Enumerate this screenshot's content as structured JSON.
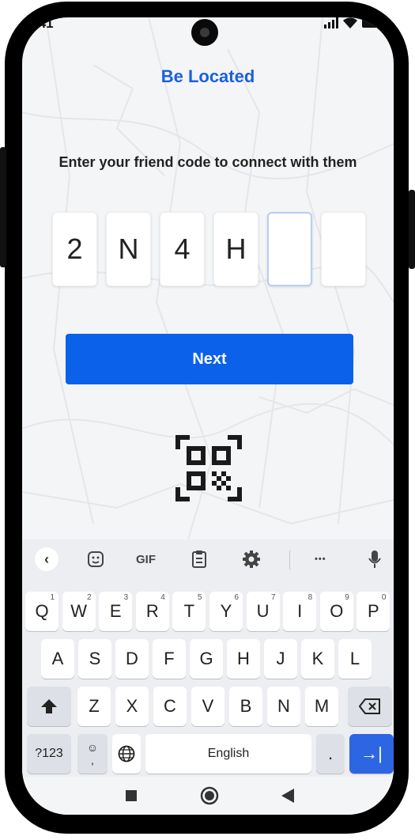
{
  "status": {
    "time": ".41"
  },
  "app": {
    "brand": "Be Located"
  },
  "connect": {
    "prompt": "Enter your friend code to connect with them",
    "code_chars": [
      "2",
      "N",
      "4",
      "H",
      "",
      ""
    ],
    "next_label": "Next"
  },
  "keyboard": {
    "toolbar": {
      "gif_label": "GIF",
      "more_label": "•••"
    },
    "row1": [
      {
        "key": "Q",
        "hint": "1"
      },
      {
        "key": "W",
        "hint": "2"
      },
      {
        "key": "E",
        "hint": "3"
      },
      {
        "key": "R",
        "hint": "4"
      },
      {
        "key": "T",
        "hint": "5"
      },
      {
        "key": "Y",
        "hint": "6"
      },
      {
        "key": "U",
        "hint": "7"
      },
      {
        "key": "I",
        "hint": "8"
      },
      {
        "key": "O",
        "hint": "9"
      },
      {
        "key": "P",
        "hint": "0"
      }
    ],
    "row2": [
      "A",
      "S",
      "D",
      "F",
      "G",
      "H",
      "J",
      "K",
      "L"
    ],
    "row3": [
      "Z",
      "X",
      "C",
      "V",
      "B",
      "N",
      "M"
    ],
    "sym_label": "?123",
    "emoji_sub": ",",
    "space_label": "English",
    "period_label": ".",
    "enter_label": "→|"
  },
  "colors": {
    "brand": "#1a5fe0",
    "button": "#0b61ea",
    "enter_key": "#2c66e3"
  }
}
